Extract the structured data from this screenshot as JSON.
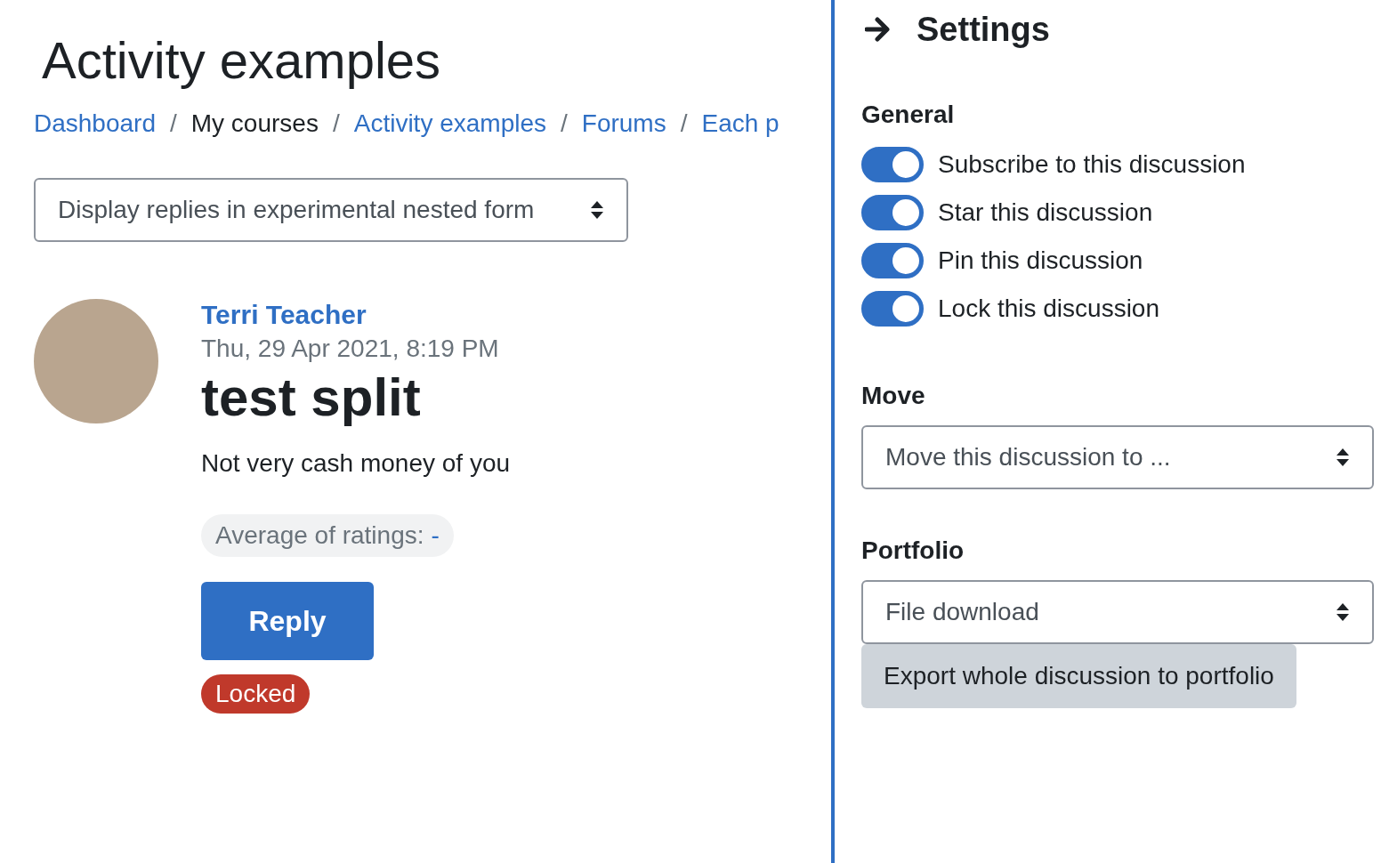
{
  "page": {
    "title": "Activity examples"
  },
  "breadcrumb": [
    {
      "label": "Dashboard",
      "link": true
    },
    {
      "label": "My courses",
      "link": false
    },
    {
      "label": "Activity examples",
      "link": true
    },
    {
      "label": "Forums",
      "link": true
    },
    {
      "label": "Each p",
      "link": true
    }
  ],
  "breadcrumb_separator": "/",
  "display_mode_select": {
    "value": "Display replies in experimental nested form"
  },
  "post": {
    "author": "Terri Teacher",
    "date": "Thu, 29 Apr 2021, 8:19 PM",
    "subject": "test split",
    "body": "Not very cash money of you",
    "rating_label": "Average of ratings:",
    "rating_value": "-",
    "reply_button": "Reply",
    "status_badge": "Locked"
  },
  "settings_drawer": {
    "title": "Settings",
    "general": {
      "heading": "General",
      "toggles": [
        {
          "label": "Subscribe to this discussion",
          "on": true
        },
        {
          "label": "Star this discussion",
          "on": true
        },
        {
          "label": "Pin this discussion",
          "on": true
        },
        {
          "label": "Lock this discussion",
          "on": true
        }
      ]
    },
    "move": {
      "heading": "Move",
      "select_value": "Move this discussion to ..."
    },
    "portfolio": {
      "heading": "Portfolio",
      "select_value": "File download",
      "export_button": "Export whole discussion to portfolio"
    }
  }
}
